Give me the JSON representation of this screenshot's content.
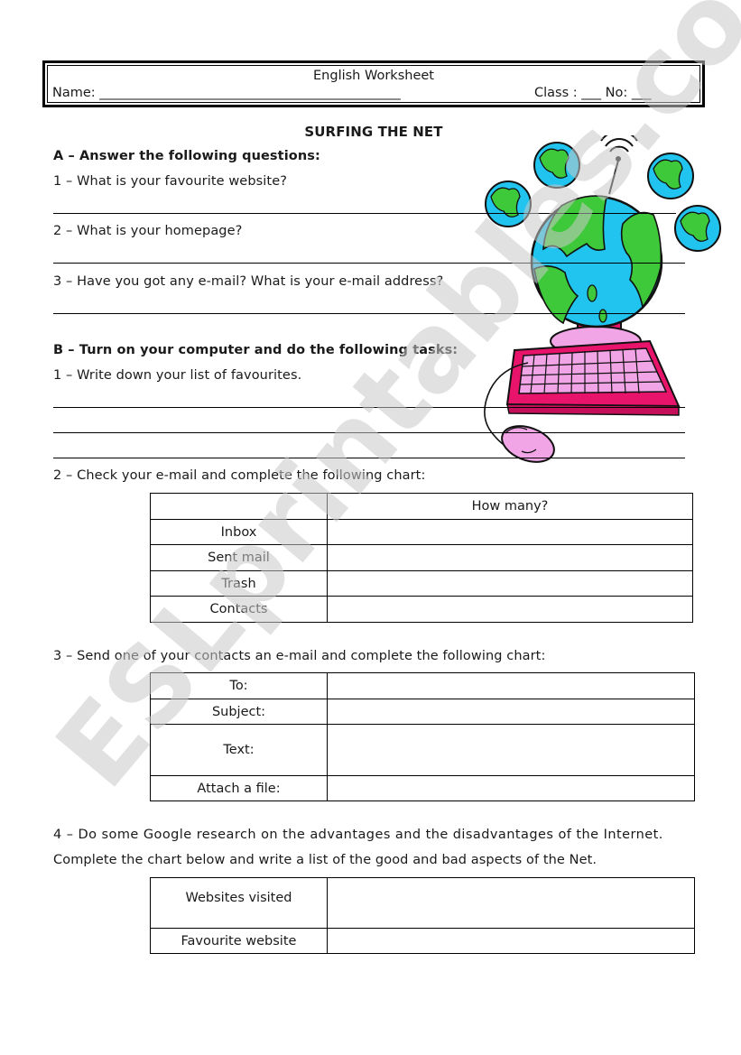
{
  "header": {
    "title": "English Worksheet",
    "name_label": "Name: ______________________________________________",
    "class_label": "Class : ___  No: ___"
  },
  "worksheet_title": "SURFING THE NET",
  "section_a": {
    "heading": "A – Answer the following questions:",
    "questions": [
      "1 – What is your favourite website?",
      "2 – What is your homepage?",
      "3 – Have you got any e-mail? What is your e-mail address?"
    ]
  },
  "section_b": {
    "heading": "B – Turn on your computer and do the following tasks:",
    "task1": "1 – Write down your list of favourites.",
    "task2": "2 – Check your e-mail and complete the following chart:",
    "chart1": {
      "header": "How many?",
      "rows": [
        "Inbox",
        "Sent mail",
        "Trash",
        "Contacts"
      ]
    },
    "task3": "3 – Send one of your contacts an e-mail and complete the following chart:",
    "chart2": {
      "rows": [
        "To:",
        "Subject:",
        "Text:",
        "Attach a file:"
      ]
    },
    "task4_line1": " 4 – Do some Google research on the advantages and the disadvantages of the Internet.",
    "task4_line2": "Complete the chart below and write a list of the good and bad aspects of the Net.",
    "chart3": {
      "rows": [
        "Websites visited",
        "Favourite website"
      ]
    }
  },
  "illustration": {
    "description": "computer-globe-clipart",
    "colors": {
      "ocean": "#21c4ef",
      "land": "#3ec93a",
      "keyboard": "#e8136b",
      "keys": "#f1a5e6"
    }
  },
  "watermark": {
    "text": "ESLprintables.com",
    "color": "#c8c8c8"
  }
}
